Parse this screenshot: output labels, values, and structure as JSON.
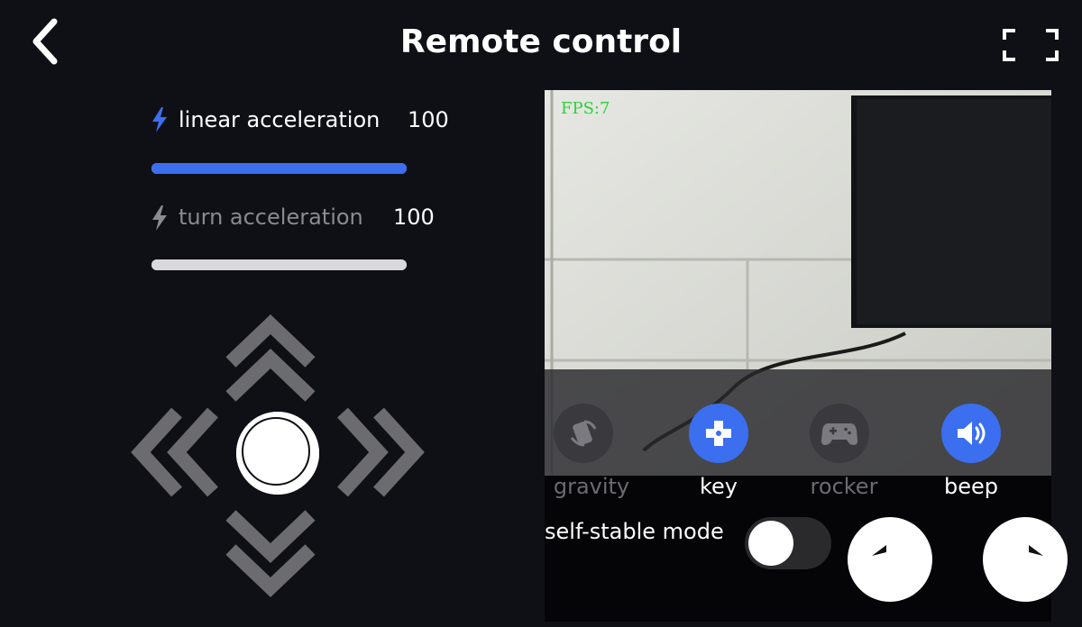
{
  "header": {
    "title": "Remote control",
    "back_icon": "chevron-left-icon",
    "fullscreen_icon": "fullscreen-icon"
  },
  "sliders": [
    {
      "label": "linear acceleration",
      "value": "100",
      "level": 1.0,
      "active": true
    },
    {
      "label": "turn acceleration",
      "value": "100",
      "level": 1.0,
      "active": false
    }
  ],
  "camera": {
    "fps_text": "FPS:7"
  },
  "modes": [
    {
      "label": "gravity",
      "icon": "gravity-icon",
      "enabled": false
    },
    {
      "label": "key",
      "icon": "dpad-icon",
      "enabled": true
    },
    {
      "label": "rocker",
      "icon": "gamepad-icon",
      "enabled": false
    },
    {
      "label": "beep",
      "icon": "speaker-icon",
      "enabled": true
    }
  ],
  "controls": {
    "self_stable_label": "self-stable mode",
    "self_stable_on": false,
    "rotate_left_icon": "rotate-left-icon",
    "rotate_right_icon": "rotate-right-icon"
  },
  "colors": {
    "accent": "#3b6ff0",
    "background": "#0f1016",
    "fps_text": "#2bd23c",
    "disabled": "#6b6b70"
  }
}
